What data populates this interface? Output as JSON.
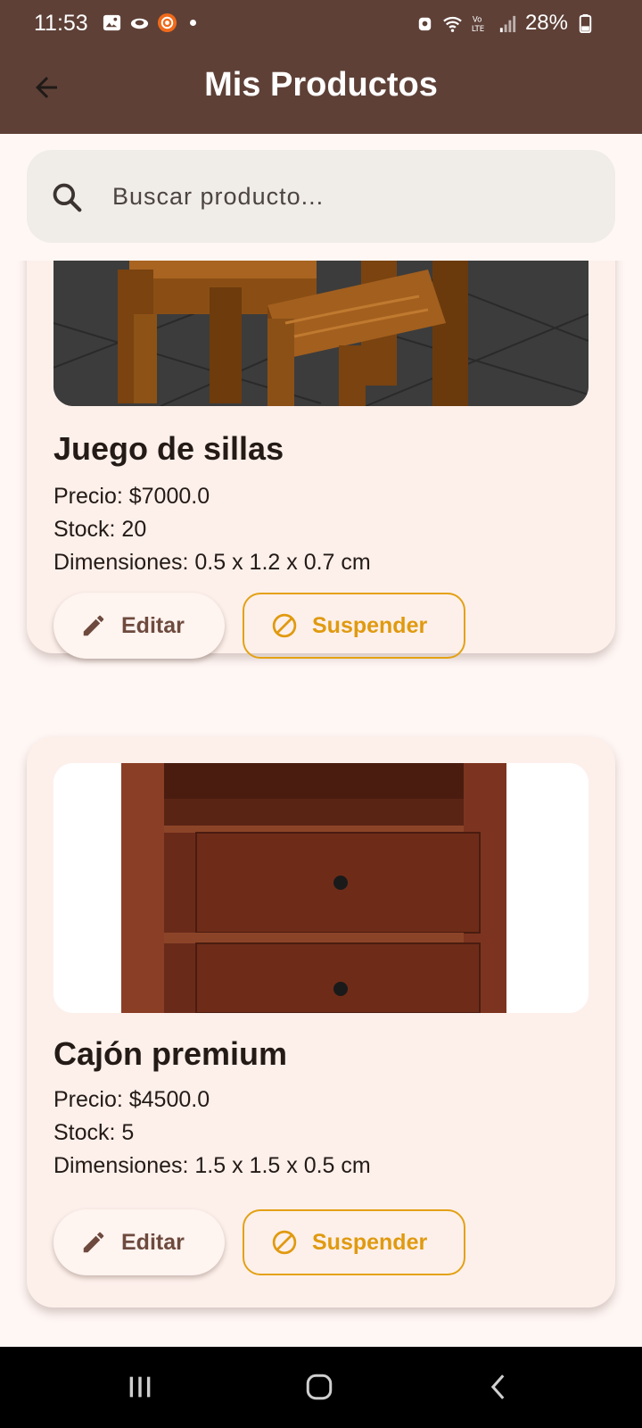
{
  "status_bar": {
    "time": "11:53",
    "battery": "28%",
    "icons_left": [
      "gallery-icon",
      "cloud-icon",
      "record-icon",
      "notification-dot"
    ],
    "icons_right": [
      "alarm-icon",
      "wifi-icon",
      "volte-icon",
      "signal-icon",
      "battery-icon"
    ]
  },
  "app_bar": {
    "title": "Mis Productos",
    "back_icon": "arrow-back-icon",
    "background": "#5e4037"
  },
  "search": {
    "placeholder": "Buscar producto...",
    "value": ""
  },
  "products": [
    {
      "name": "Juego de sillas",
      "price": "Precio: $7000.0",
      "stock": "Stock: 20",
      "dimensions": "Dimensiones: 0.5 x 1.2 x 0.7 cm",
      "edit_label": "Editar",
      "suspend_label": "Suspender"
    },
    {
      "name": "Cajón premium",
      "price": "Precio: $4500.0",
      "stock": "Stock: 5",
      "dimensions": "Dimensiones: 1.5 x 1.5 x 0.5 cm",
      "edit_label": "Editar",
      "suspend_label": "Suspender"
    }
  ],
  "colors": {
    "accent_orange": "#e3a114",
    "brown": "#5e4037",
    "card_bg": "#fdf0eb"
  },
  "nav_bar": {
    "buttons": [
      "recent-apps-icon",
      "home-icon",
      "back-icon"
    ]
  }
}
